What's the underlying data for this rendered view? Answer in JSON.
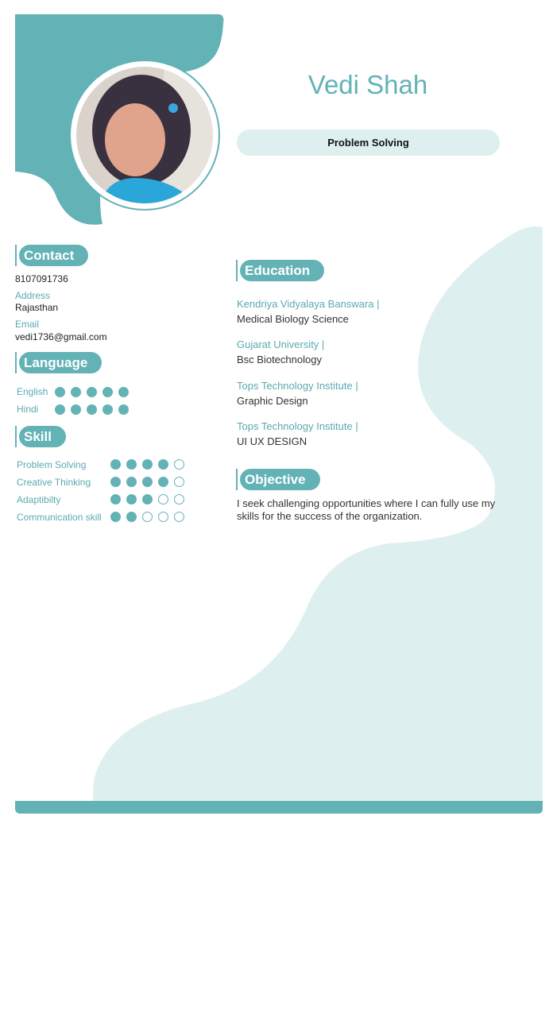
{
  "profile": {
    "name": "Vedi Shah",
    "headline": "Problem Solving"
  },
  "contact": {
    "title": "Contact",
    "phone": "8107091736",
    "address_label": "Address",
    "address": "Rajasthan",
    "email_label": "Email",
    "email": "vedi1736@gmail.com"
  },
  "language": {
    "title": "Language",
    "items": [
      {
        "name": "English",
        "level": 5,
        "max": 5
      },
      {
        "name": "Hindi",
        "level": 5,
        "max": 5
      }
    ]
  },
  "skill": {
    "title": "Skill",
    "items": [
      {
        "name": "Problem Solving",
        "level": 4,
        "max": 5
      },
      {
        "name": "Creative Thinking",
        "level": 4,
        "max": 5
      },
      {
        "name": "Adaptibilty",
        "level": 3,
        "max": 5
      },
      {
        "name": "Communication skill",
        "level": 2,
        "max": 5
      }
    ]
  },
  "education": {
    "title": "Education",
    "items": [
      {
        "institute": "Kendriya Vidyalaya Banswara |",
        "degree": "Medical Biology Science"
      },
      {
        "institute": "Gujarat University |",
        "degree": "Bsc Biotechnology"
      },
      {
        "institute": "Tops Technology Institute |",
        "degree": "Graphic Design"
      },
      {
        "institute": "Tops Technology Institute |",
        "degree": "UI UX DESIGN"
      }
    ]
  },
  "objective": {
    "title": "Objective",
    "text": "I seek challenging opportunities where I can fully use my skills for the success of the organization."
  },
  "colors": {
    "accent": "#63b2b6",
    "light": "#deeff0"
  }
}
